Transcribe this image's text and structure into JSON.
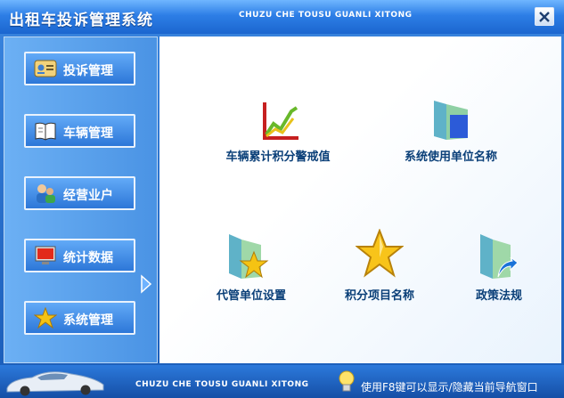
{
  "window": {
    "title": "出租车投诉管理系统",
    "subtitle": "CHUZU CHE TOUSU GUANLI XITONG"
  },
  "sidebar": {
    "items": [
      {
        "label": "投诉管理",
        "icon": "complaint-card-icon"
      },
      {
        "label": "车辆管理",
        "icon": "book-icon"
      },
      {
        "label": "经营业户",
        "icon": "users-icon"
      },
      {
        "label": "统计数据",
        "icon": "monitor-icon"
      },
      {
        "label": "系统管理",
        "icon": "star-icon"
      }
    ]
  },
  "main": {
    "items": [
      {
        "label": "车辆累计积分警戒值",
        "icon": "line-chart-icon"
      },
      {
        "label": "系统使用单位名称",
        "icon": "folder-icon"
      },
      {
        "label": "代管单位设置",
        "icon": "folder-star-icon"
      },
      {
        "label": "积分项目名称",
        "icon": "star-icon"
      },
      {
        "label": "政策法规",
        "icon": "folder-arrow-icon"
      }
    ]
  },
  "footer": {
    "subtitle": "CHUZU CHE TOUSU GUANLI XITONG",
    "hint": "使用F8键可以显示/隐藏当前导航窗口"
  }
}
